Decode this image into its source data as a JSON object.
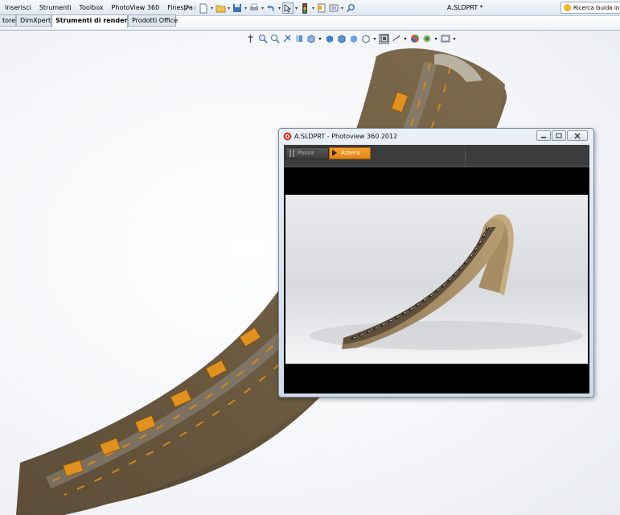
{
  "menubar": {
    "menus": [
      "Inserisci",
      "Strumenti",
      "Toolbox",
      "PhotoView 360",
      "Finestra",
      "?"
    ],
    "document_title": "A.SLDPRT *",
    "help_search_placeholder": "Ricerca Guida in li"
  },
  "command_tabs": [
    {
      "label": "tore",
      "active": false
    },
    {
      "label": "DimXpert",
      "active": false
    },
    {
      "label": "Strumenti di rendering",
      "active": true
    },
    {
      "label": "Prodotti Office",
      "active": false
    }
  ],
  "photoview": {
    "window_title": "A.SLDPRT - Photoview 360 2012",
    "pause_label": "Pausa",
    "reset_label": "Azzera"
  },
  "colors": {
    "accent_orange": "#f39a23",
    "model_ramp": "#6b5a3f",
    "model_track": "#d88a1e"
  }
}
